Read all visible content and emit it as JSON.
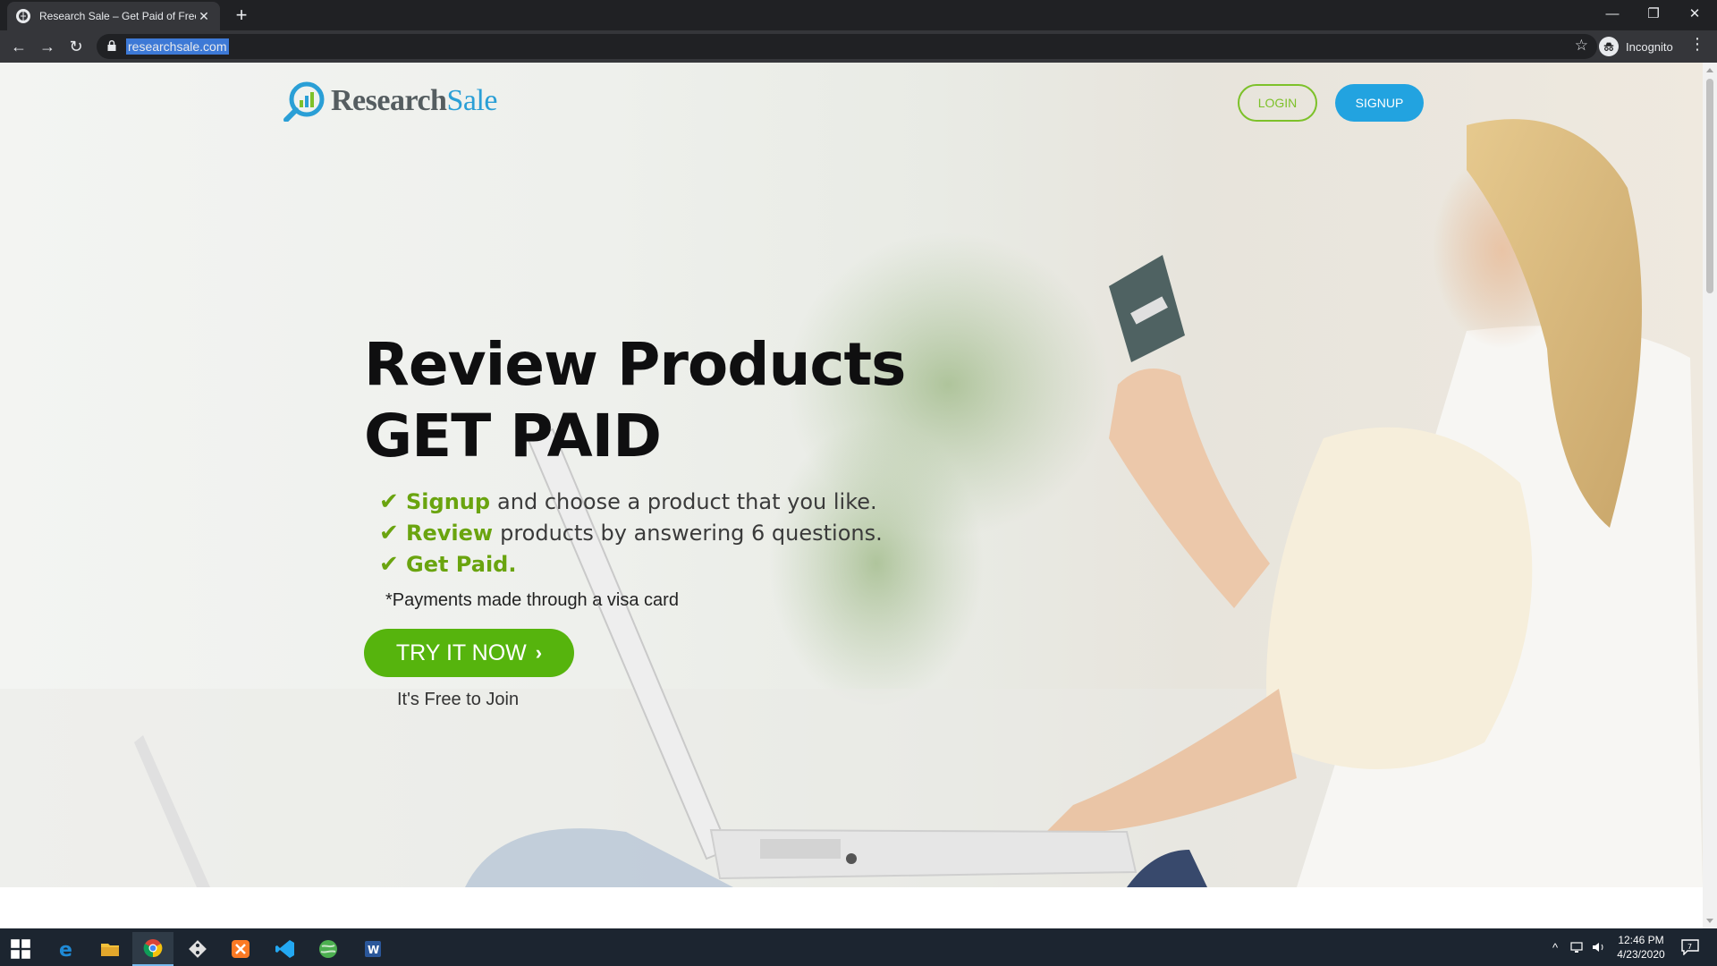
{
  "browser": {
    "tab_title": "Research Sale – Get Paid of Free",
    "tab_close": "✕",
    "new_tab": "+",
    "url": "researchsale.com",
    "profile_label": "Incognito",
    "window_controls": {
      "minimize": "—",
      "restore": "❐",
      "close": "✕"
    },
    "nav": {
      "back": "←",
      "forward": "→",
      "reload": "↻"
    },
    "bookmark_star": "☆",
    "menu": "⋮"
  },
  "site": {
    "logo": {
      "research": "Research",
      "sale": "Sale"
    },
    "login_label": "LOGIN",
    "signup_label": "SIGNUP",
    "headline_line1": "Review Products",
    "headline_line2": "GET PAID",
    "steps": [
      {
        "strong": "Signup",
        "rest": "and choose a product that you like."
      },
      {
        "strong": "Review",
        "rest": "products by answering 6 questions."
      },
      {
        "strong": "Get Paid.",
        "rest": ""
      }
    ],
    "check_glyph": "✔",
    "payments_note": "*Payments made through a visa card",
    "cta_label": "TRY IT NOW",
    "cta_arrow": "›",
    "free_note": "It's Free to Join",
    "colors": {
      "accent_green": "#56b40d",
      "accent_blue": "#22a3e0",
      "check_green": "#6aa40f"
    }
  },
  "taskbar": {
    "apps": [
      "windows-start-icon",
      "edge-icon",
      "file-explorer-icon",
      "chrome-icon",
      "git-icon",
      "xampp-icon",
      "vscode-icon",
      "browser-globe-icon",
      "word-icon"
    ],
    "tray": {
      "chevron": "^",
      "notification_count": "7"
    },
    "time": "12:46 PM",
    "date": "4/23/2020"
  }
}
